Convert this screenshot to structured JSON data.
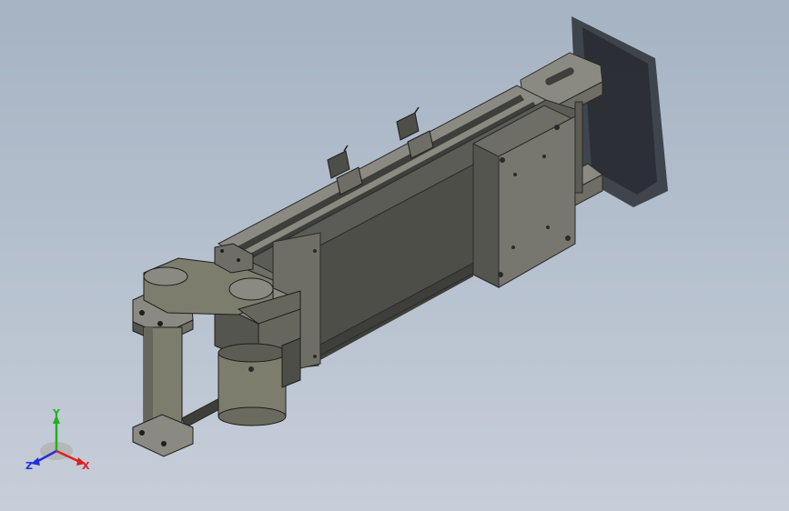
{
  "viewport": {
    "background_top": "#a6b3c3",
    "background_bottom": "#c6ced9"
  },
  "model": {
    "body_color": "#5c5c56",
    "body_dark": "#3e3e3a",
    "body_light": "#8a8a82",
    "motor_color": "#7d7d6e",
    "shadow_color": "#2c3036"
  },
  "triad": {
    "x_label": "X",
    "y_label": "Y",
    "z_label": "Z",
    "x_color": "#e02020",
    "y_color": "#20b020",
    "z_color": "#2030e0"
  }
}
